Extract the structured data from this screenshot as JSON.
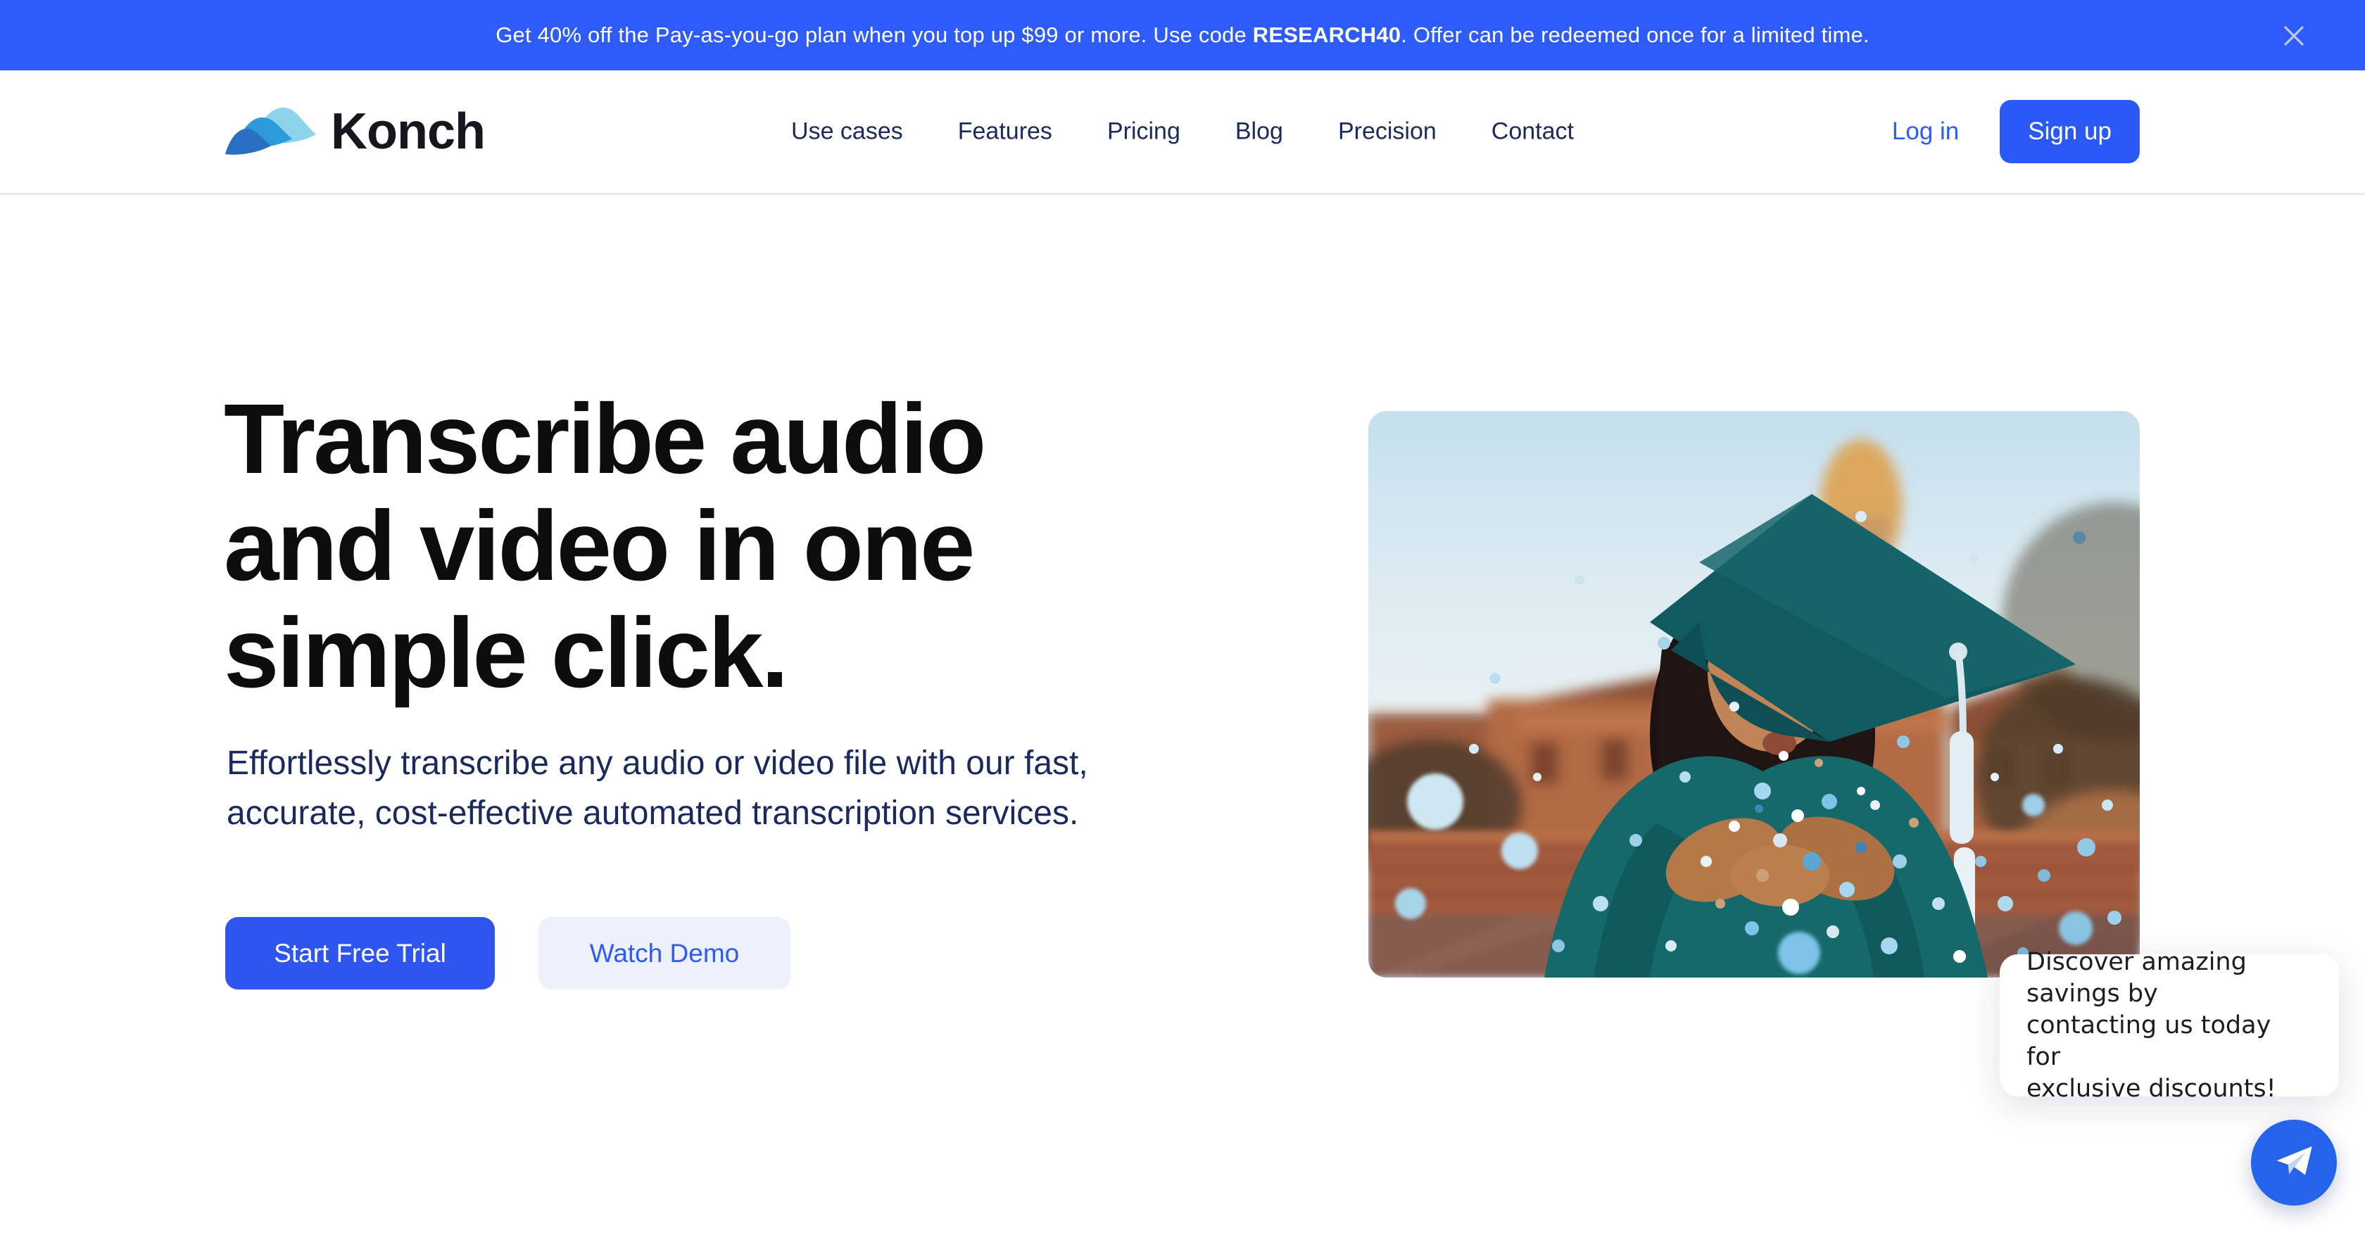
{
  "banner": {
    "text_prefix": "Get 40% off the Pay-as-you-go plan when you top up $99 or more. Use code ",
    "code": "RESEARCH40",
    "text_suffix": ". Offer can be redeemed once for a limited time.",
    "close_icon": "x-icon"
  },
  "header": {
    "brand": "Konch",
    "logo_icon": "wave-logo-icon",
    "nav": [
      "Use cases",
      "Features",
      "Pricing",
      "Blog",
      "Precision",
      "Contact"
    ],
    "login_label": "Log in",
    "signup_label": "Sign up"
  },
  "hero": {
    "title_lines": [
      "Transcribe audio",
      "and video in one",
      "simple click."
    ],
    "subtitle_lines": [
      "Effortlessly transcribe any audio or video file with our fast,",
      "accurate, cost-effective automated transcription services."
    ],
    "cta_primary": "Start Free Trial",
    "cta_secondary": "Watch Demo",
    "image_alt": "Graduate in teal cap and gown blowing blue confetti"
  },
  "chat": {
    "tooltip_lines": [
      "Discover amazing savings by",
      "contacting us today for",
      "exclusive discounts!"
    ],
    "button_icon": "paper-plane-icon"
  },
  "colors": {
    "banner_blue": "#2e5bfb",
    "primary_blue": "#2b59f7",
    "cta_blue": "#2f55f0",
    "secondary_btn_bg": "#edf1fb",
    "dark_navy": "#1b2a5e",
    "heading_black": "#0d0d10",
    "chat_blue": "#2563ea",
    "logo_wave_light": "#8ed3ec",
    "logo_wave_mid": "#2d9bd9",
    "logo_wave_dark": "#2970c2"
  }
}
